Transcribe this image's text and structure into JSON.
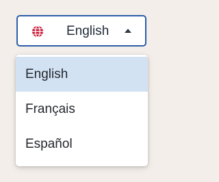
{
  "language_selector": {
    "current": "English",
    "icon": "globe-icon",
    "icon_color": "#c8102e",
    "caret": "caret-up-icon",
    "border_color": "#2a5da8"
  },
  "menu": {
    "items": [
      {
        "label": "English",
        "selected": true
      },
      {
        "label": "Français",
        "selected": false
      },
      {
        "label": "Español",
        "selected": false
      }
    ],
    "selected_bg": "#d3e2f3"
  }
}
